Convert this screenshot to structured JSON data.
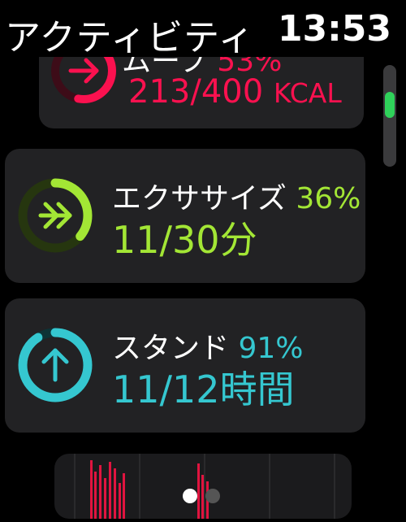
{
  "status_bar": {
    "app_title": "アクティビティ",
    "time": "13:53"
  },
  "colors": {
    "move": "#fa114f",
    "exercise": "#a3e635",
    "stand": "#35c7d0",
    "scroll_thumb": "#2fd15a"
  },
  "metrics": {
    "move": {
      "name": "ムーブ",
      "percent": "53%",
      "value": "213/400",
      "unit": "KCAL",
      "progress": 0.53,
      "icon": "arrow-right-icon"
    },
    "exercise": {
      "name": "エクササイズ",
      "percent": "36%",
      "value": "11/30分",
      "progress": 0.36,
      "icon": "double-arrow-right-icon"
    },
    "stand": {
      "name": "スタンド",
      "percent": "91%",
      "value": "11/12時間",
      "progress": 0.91,
      "icon": "arrow-up-icon"
    }
  },
  "pagination": {
    "current": 1,
    "total": 2
  },
  "scroll": {
    "position": 0.35
  }
}
